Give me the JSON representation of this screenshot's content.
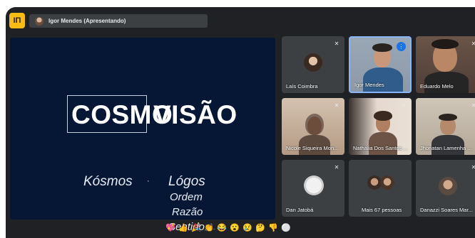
{
  "app": {
    "logo_text": "IΠ"
  },
  "presenter_chip": {
    "name": "Igor Mendes (Apresentando)"
  },
  "slide": {
    "title_left": "COSMO",
    "title_right": "VISÃO",
    "word1": "Kósmos",
    "separator": "·",
    "word2": "Lógos",
    "meanings": [
      "Ordem",
      "Razão",
      "Sentido"
    ]
  },
  "participants": [
    {
      "name": "Laís Coimbra",
      "status": "muted"
    },
    {
      "name": "Igor Mendes",
      "status": "speaking"
    },
    {
      "name": "Eduardo Melo",
      "status": "muted"
    },
    {
      "name": "Nicole Siqueira Mon...",
      "status": "muted"
    },
    {
      "name": "Nathália Dos Santos ...",
      "status": "muted"
    },
    {
      "name": "Jhonatan Lamenha ...",
      "status": "muted"
    },
    {
      "name": "Dan Jatobá",
      "status": "muted"
    },
    {
      "name": "Mais 67 pessoas",
      "status": "group"
    },
    {
      "name": "Danazzi Soares Mar...",
      "status": "muted"
    }
  ],
  "reactions": [
    "💖",
    "👍",
    "🎉",
    "👏",
    "😂",
    "😮",
    "😢",
    "🤔",
    "👎",
    "⚪"
  ]
}
